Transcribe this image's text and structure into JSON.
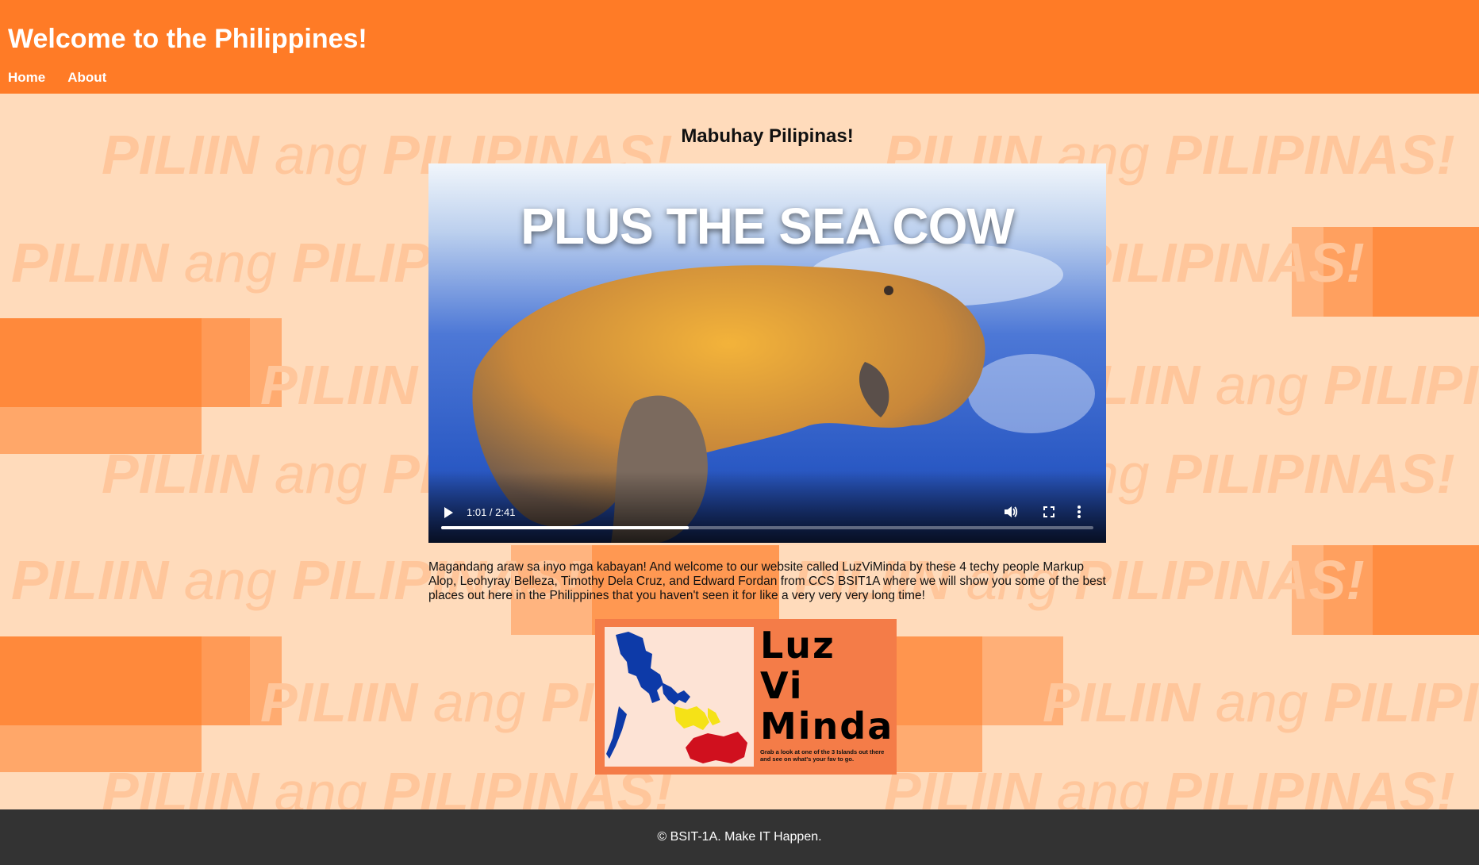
{
  "header": {
    "title": "Welcome to the Philippines!",
    "nav": [
      {
        "label": "Home"
      },
      {
        "label": "About"
      }
    ],
    "color": "#ff7b26"
  },
  "background": {
    "watermark": {
      "word1": "PILIIN",
      "word2": "ang",
      "word3": "PILIPINAS!"
    },
    "color": "#ffdbbb"
  },
  "main": {
    "heading": "Mabuhay Pilipinas!",
    "video": {
      "caption": "PLUS THE SEA COW",
      "time": "1:01 / 2:41",
      "progress": 0.379,
      "icons": [
        "play-icon",
        "volume-icon",
        "fullscreen-icon",
        "more-options-icon"
      ]
    },
    "intro": "Magandang araw sa inyo mga kabayan! And welcome to our website called LuzViMinda by these 4 techy people Markup Alop, Leohyray Belleza, Timothy Dela Cruz, and Edward Fordan from CCS BSIT1A where we will show you some of the best places out here in the Philippines that you haven't seen it for like a very very very long time!",
    "logo": {
      "line1": "Luz",
      "line2": "Vi",
      "line3": "Minda",
      "tagline_pre": "Grab a look at one of the ",
      "tagline_bold": "3 Islands",
      "tagline_post": " out there and see on what's your fav to go.",
      "colors": {
        "luzon": "#0d3aa8",
        "visayas": "#f5e217",
        "mindanao": "#d0101e",
        "background": "#f47c48"
      }
    }
  },
  "footer": {
    "text": "© BSIT-1A. Make IT Happen.",
    "color": "#333333"
  }
}
